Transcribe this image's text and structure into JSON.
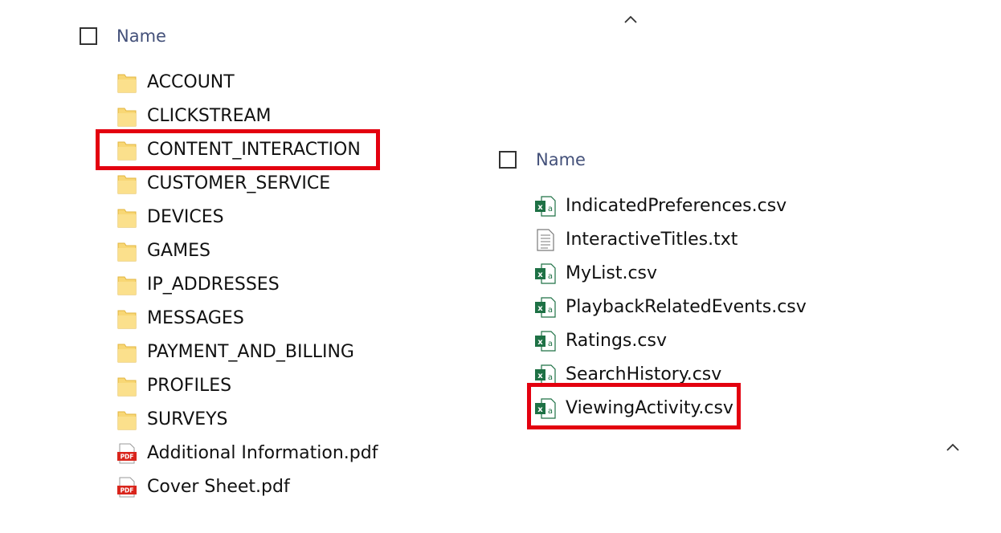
{
  "accent": {
    "highlight": "#e3000f",
    "header_text": "#44517a",
    "folder": "#f8d775",
    "excel": "#1e7145",
    "pdf": "#d9251c"
  },
  "left_pane": {
    "header": {
      "name_label": "Name",
      "sort_icon": "chevron-up-icon"
    },
    "items": [
      {
        "label": "ACCOUNT",
        "icon": "folder-icon"
      },
      {
        "label": "CLICKSTREAM",
        "icon": "folder-icon"
      },
      {
        "label": "CONTENT_INTERACTION",
        "icon": "folder-icon",
        "highlighted": true
      },
      {
        "label": "CUSTOMER_SERVICE",
        "icon": "folder-icon"
      },
      {
        "label": "DEVICES",
        "icon": "folder-icon"
      },
      {
        "label": "GAMES",
        "icon": "folder-icon"
      },
      {
        "label": "IP_ADDRESSES",
        "icon": "folder-icon"
      },
      {
        "label": "MESSAGES",
        "icon": "folder-icon"
      },
      {
        "label": "PAYMENT_AND_BILLING",
        "icon": "folder-icon"
      },
      {
        "label": "PROFILES",
        "icon": "folder-icon"
      },
      {
        "label": "SURVEYS",
        "icon": "folder-icon"
      },
      {
        "label": "Additional Information.pdf",
        "icon": "pdf-icon"
      },
      {
        "label": "Cover Sheet.pdf",
        "icon": "pdf-icon"
      }
    ]
  },
  "right_pane": {
    "header": {
      "name_label": "Name",
      "sort_icon": "chevron-up-icon"
    },
    "items": [
      {
        "label": "IndicatedPreferences.csv",
        "icon": "excel-icon"
      },
      {
        "label": "InteractiveTitles.txt",
        "icon": "text-file-icon"
      },
      {
        "label": "MyList.csv",
        "icon": "excel-icon"
      },
      {
        "label": "PlaybackRelatedEvents.csv",
        "icon": "excel-icon"
      },
      {
        "label": "Ratings.csv",
        "icon": "excel-icon"
      },
      {
        "label": "SearchHistory.csv",
        "icon": "excel-icon"
      },
      {
        "label": "ViewingActivity.csv",
        "icon": "excel-icon",
        "highlighted": true
      }
    ]
  }
}
